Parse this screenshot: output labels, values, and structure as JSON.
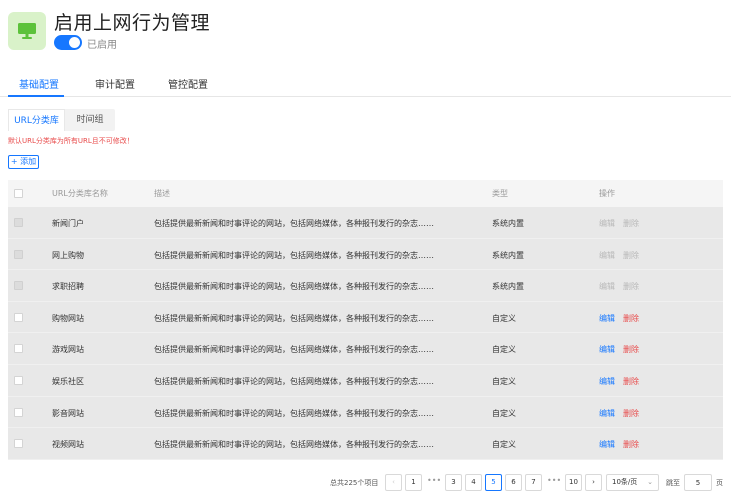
{
  "header": {
    "title": "启用上网行为管理",
    "toggle_label": "已启用",
    "icon": "monitor-icon",
    "brand_color": "#1677ff"
  },
  "main_tabs": [
    {
      "label": "基础配置",
      "active": true
    },
    {
      "label": "审计配置",
      "active": false
    },
    {
      "label": "管控配置",
      "active": false
    }
  ],
  "sub_tabs": [
    {
      "label": "URL分类库",
      "active": true
    },
    {
      "label": "时间组",
      "active": false
    }
  ],
  "notice": "默认URL分类库为所有URL且不可修改！",
  "add_button": "+ 添加",
  "table": {
    "columns": [
      "URL分类库名称",
      "描述",
      "类型",
      "操作"
    ],
    "rows": [
      {
        "name": "新闻门户",
        "desc": "包括提供最新新闻和时事评论的网站，包括网络媒体，各种报刊发行的杂志……",
        "type": "系统内置",
        "edit": "编辑",
        "delete": "删除",
        "disabled": true
      },
      {
        "name": "网上购物",
        "desc": "包括提供最新新闻和时事评论的网站，包括网络媒体，各种报刊发行的杂志……",
        "type": "系统内置",
        "edit": "编辑",
        "delete": "删除",
        "disabled": true
      },
      {
        "name": "求职招聘",
        "desc": "包括提供最新新闻和时事评论的网站，包括网络媒体，各种报刊发行的杂志……",
        "type": "系统内置",
        "edit": "编辑",
        "delete": "删除",
        "disabled": true
      },
      {
        "name": "购物网站",
        "desc": "包括提供最新新闻和时事评论的网站，包括网络媒体，各种报刊发行的杂志……",
        "type": "自定义",
        "edit": "编辑",
        "delete": "删除",
        "disabled": false
      },
      {
        "name": "游戏网站",
        "desc": "包括提供最新新闻和时事评论的网站，包括网络媒体，各种报刊发行的杂志……",
        "type": "自定义",
        "edit": "编辑",
        "delete": "删除",
        "disabled": false
      },
      {
        "name": "娱乐社区",
        "desc": "包括提供最新新闻和时事评论的网站，包括网络媒体，各种报刊发行的杂志……",
        "type": "自定义",
        "edit": "编辑",
        "delete": "删除",
        "disabled": false
      },
      {
        "name": "影音网站",
        "desc": "包括提供最新新闻和时事评论的网站，包括网络媒体，各种报刊发行的杂志……",
        "type": "自定义",
        "edit": "编辑",
        "delete": "删除",
        "disabled": false
      },
      {
        "name": "视频网站",
        "desc": "包括提供最新新闻和时事评论的网站，包括网络媒体，各种报刊发行的杂志……",
        "type": "自定义",
        "edit": "编辑",
        "delete": "删除",
        "disabled": false
      }
    ]
  },
  "pagination": {
    "total": "总共225个项目",
    "pages": [
      "1",
      "3",
      "4",
      "5",
      "6",
      "7",
      "10"
    ],
    "current": "5",
    "ellipsis": "•••",
    "prev": "‹",
    "next": "›",
    "page_size": "10条/页",
    "jump_label": "跳至",
    "jump_value": "5",
    "page_suffix": "页"
  }
}
